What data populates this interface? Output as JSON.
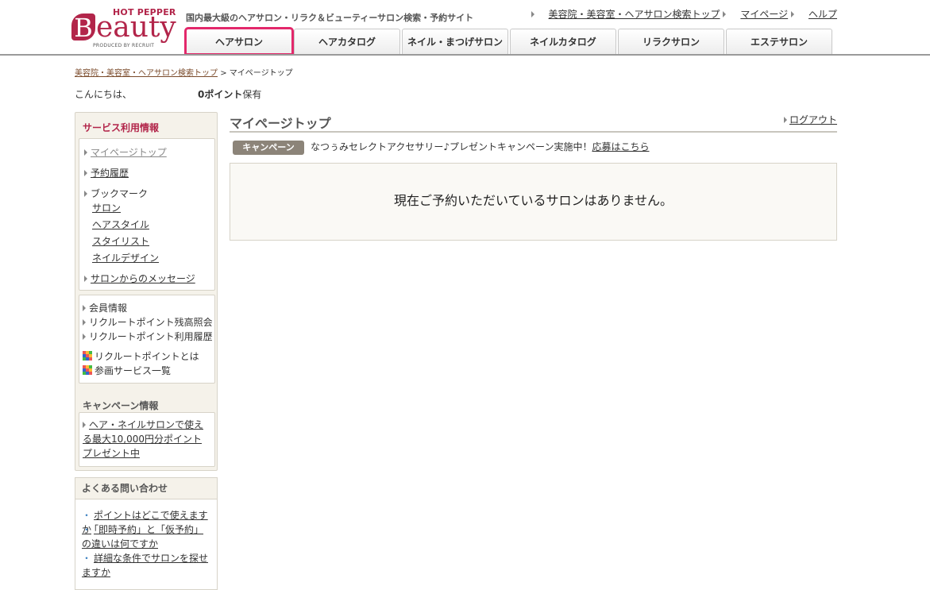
{
  "logo": {
    "brand_top": "HOT PEPPER",
    "brand_initial": "B",
    "brand_rest": "eauty",
    "produced_by": "PRODUCED BY RECRUIT"
  },
  "header": {
    "tagline": "国内最大級のヘアサロン・リラク＆ビューティーサロン検索・予約サイト",
    "links": [
      "美容院・美容室・ヘアサロン検索トップ",
      "マイページ",
      "ヘルプ"
    ]
  },
  "nav": {
    "tabs": [
      "ヘアサロン",
      "ヘアカタログ",
      "ネイル・まつげサロン",
      "ネイルカタログ",
      "リラクサロン",
      "エステサロン"
    ],
    "active": "ヘアサロン"
  },
  "breadcrumb": {
    "home": "美容院・美容室・ヘアサロン検索トップ",
    "sep": ">",
    "current": "マイページトップ"
  },
  "greeting": {
    "hello": "こんにちは、",
    "points": "0ポイント",
    "points_suffix": "保有"
  },
  "sidebar": {
    "title": "サービス利用情報",
    "group1": {
      "mypage_top": "マイページトップ",
      "history": "予約履歴",
      "bookmark": "ブックマーク",
      "bookmark_items": [
        "サロン",
        "ヘアスタイル",
        "スタイリスト",
        "ネイルデザイン"
      ],
      "messages": "サロンからのメッセージ"
    },
    "group2": {
      "member": "会員情報",
      "points_balance": "リクルートポイント残高照会",
      "points_history": "リクルートポイント利用履歴",
      "about_points": "リクルートポイントとは",
      "services": "参画サービス一覧"
    },
    "campaign_title": "キャンペーン情報",
    "campaign_link": "ヘア・ネイルサロンで使える最大10,000円分ポイントプレゼント中"
  },
  "faq": {
    "title": "よくある問い合わせ",
    "items": [
      "ポイントはどこで使えますか",
      "「即時予約」と「仮予約」の違いは何ですか",
      "詳細な条件でサロンを探せますか"
    ]
  },
  "main": {
    "title": "マイページトップ",
    "logout": "ログアウト",
    "campaign_badge": "キャンペーン",
    "campaign_text": "なつぅみセレクトアクセサリー♪プレゼントキャンペーン実施中！",
    "campaign_link": "応募はこちら",
    "empty_message": "現在ご予約いただいているサロンはありません。"
  }
}
